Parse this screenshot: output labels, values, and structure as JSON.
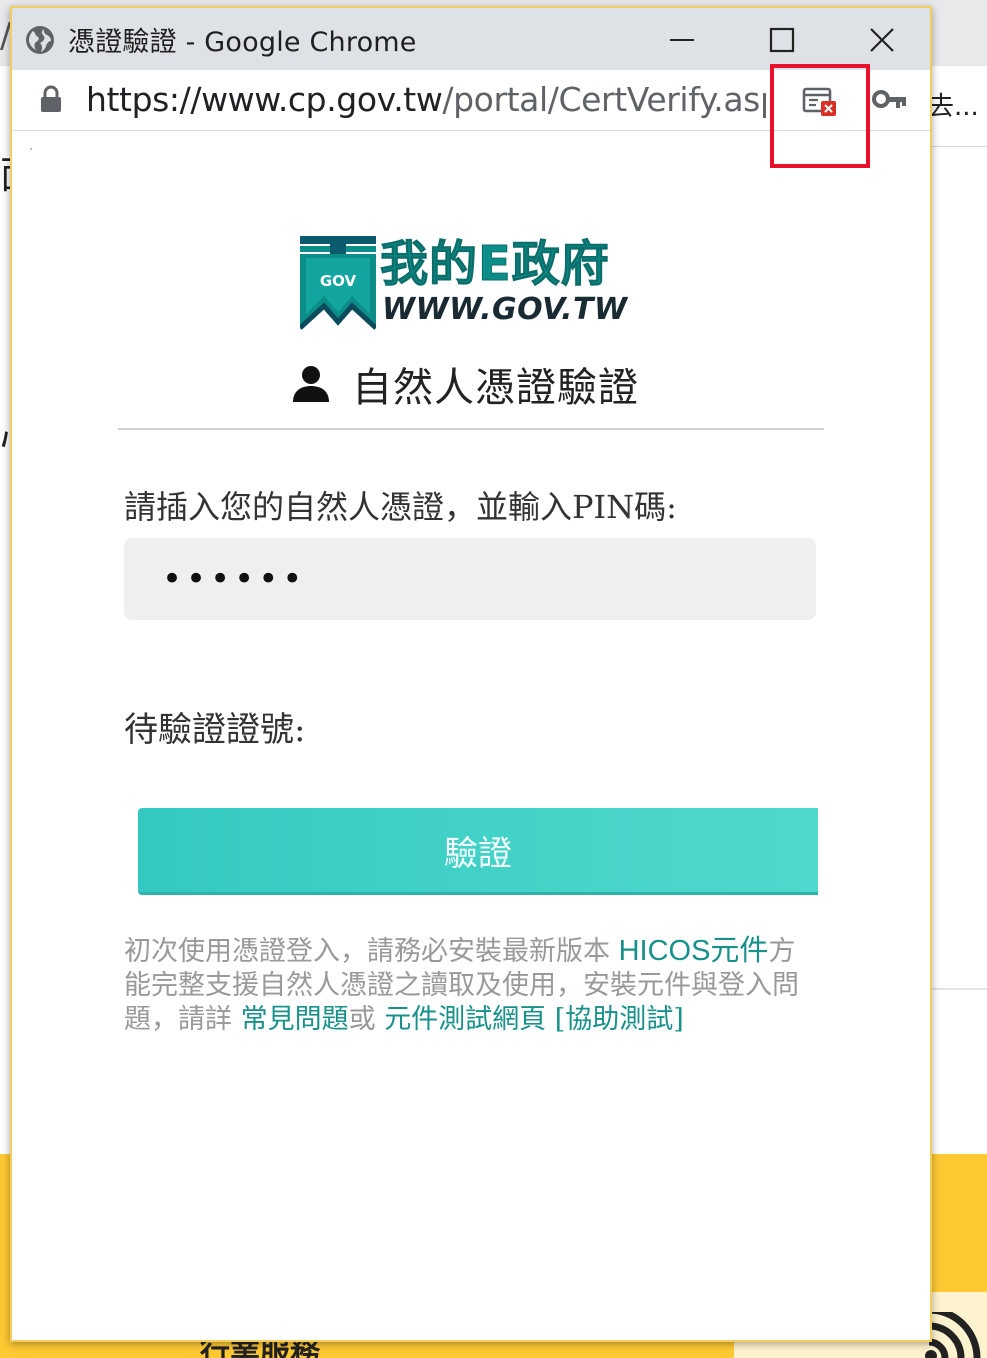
{
  "window": {
    "title": "憑證驗證 - Google Chrome",
    "url_host": "https://www.cp.gov.tw",
    "url_path": "/portal/CertVerify.aspx...",
    "icons": {
      "site": "globe-icon",
      "lock": "lock-icon",
      "popup_blocked": "popup-blocked-icon",
      "key": "key-icon",
      "minimize": "minimize-icon",
      "maximize": "maximize-icon",
      "close": "close-icon"
    }
  },
  "background": {
    "address_ellipsis": "去...",
    "left_char_1": "面",
    "left_char_2": "心",
    "bottom_text": "行業服務"
  },
  "logo": {
    "badge_text": "GOV",
    "title": "我的E政府",
    "subtitle": "WWW.GOV.TW"
  },
  "heading": {
    "icon": "user-icon",
    "text": "自然人憑證驗證"
  },
  "form": {
    "pin_label": "請插入您的自然人憑證，並輸入PIN碼:",
    "pin_value": "••••••",
    "cert_label": "待驗證證號:",
    "cert_value": "",
    "verify_button": "驗證"
  },
  "notice": {
    "text1": "初次使用憑證登入，請務必安裝最新版本 ",
    "link_hicos": "HICOS元件",
    "text2": "方能完整支援自然人憑證之讀取及使用，安裝元件與登入問題，請詳 ",
    "link_faq": "常見問題",
    "text3": "或 ",
    "link_test": "元件測試網頁 [協助測試]"
  },
  "colors": {
    "accent_teal": "#18918b",
    "button_teal": "#3fcfc5",
    "highlight_red": "#e8102a",
    "bg_yellow": "#ffc933"
  }
}
